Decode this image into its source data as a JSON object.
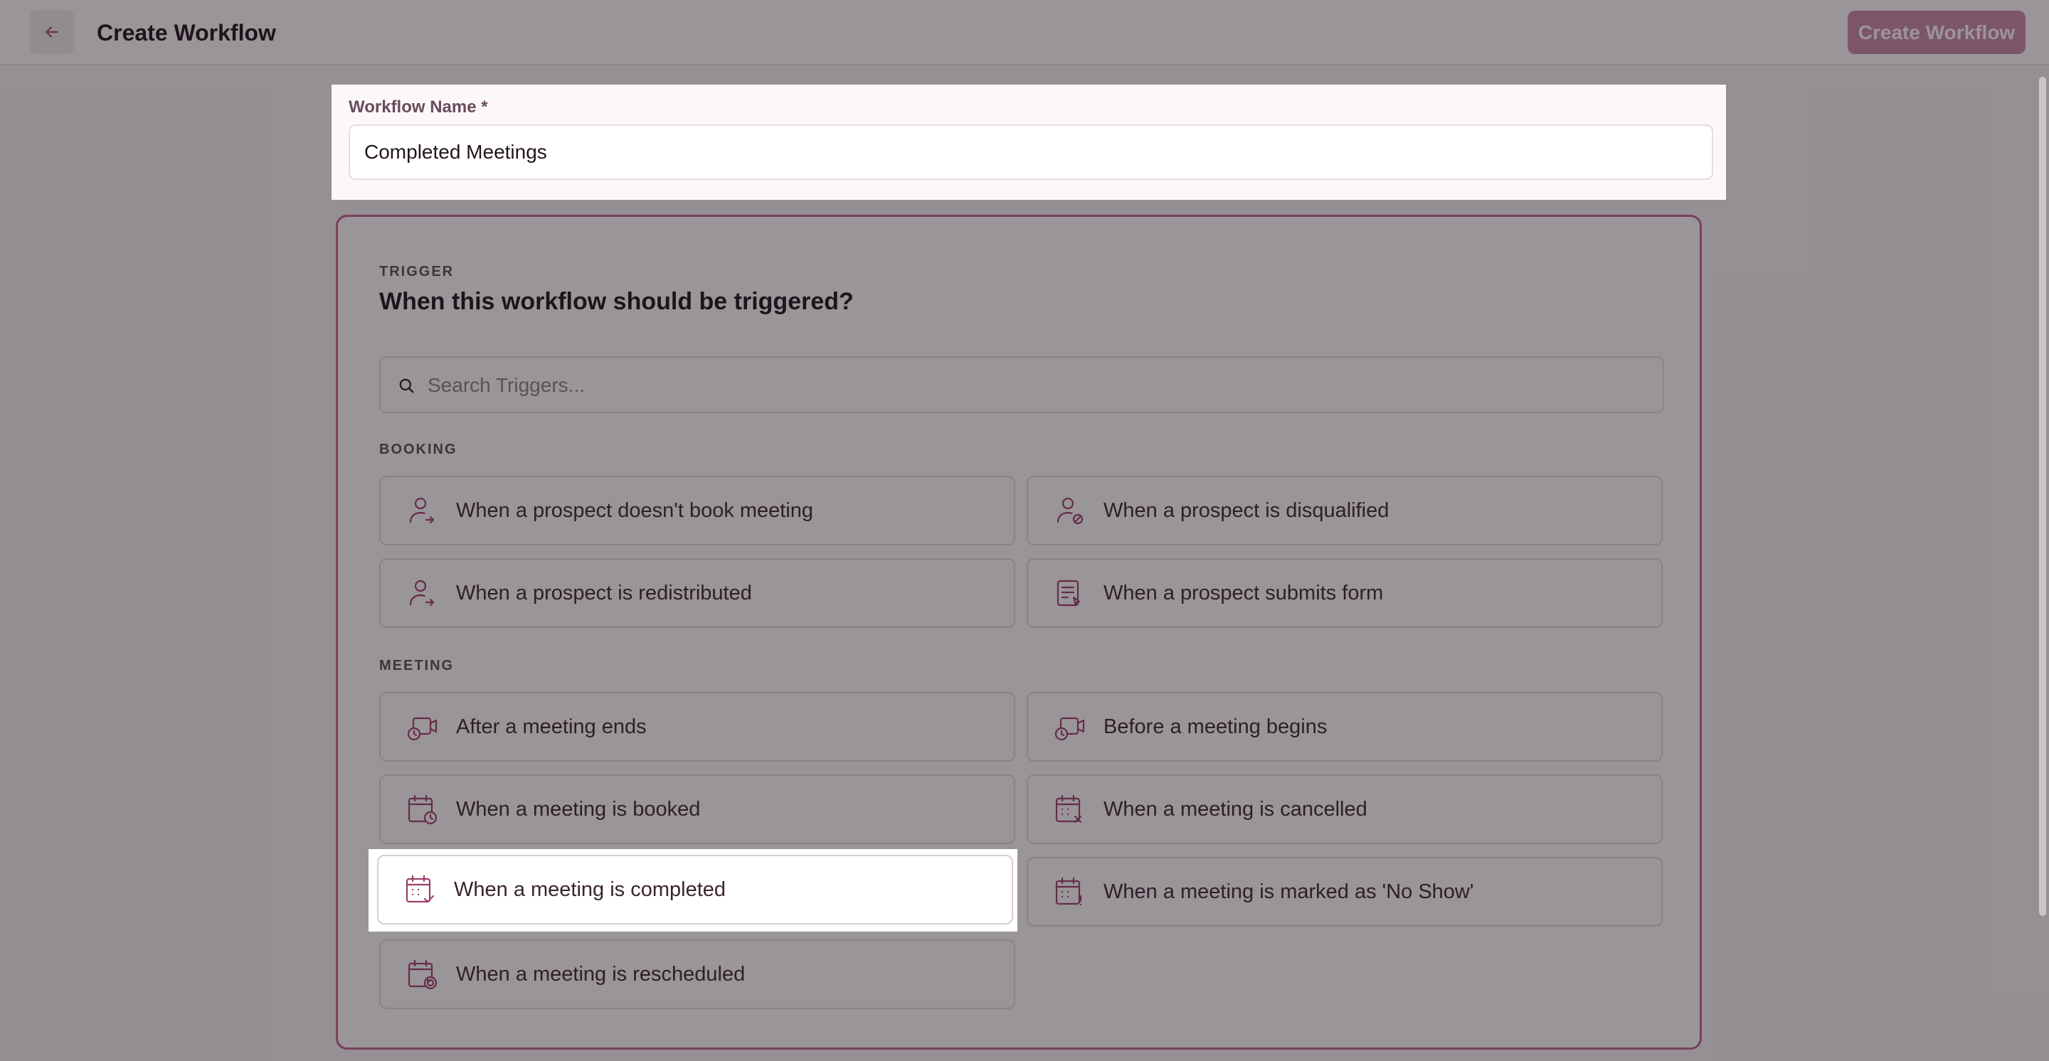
{
  "header": {
    "title": "Create Workflow",
    "primary_button": "Create Workflow"
  },
  "workflow_name": {
    "label": "Workflow Name *",
    "value": "Completed Meetings"
  },
  "trigger": {
    "eyebrow": "TRIGGER",
    "title": "When this workflow should be triggered?",
    "search_placeholder": "Search Triggers...",
    "groups": [
      {
        "label": "BOOKING",
        "options": [
          {
            "label": "When a prospect doesn't book meeting",
            "icon": "user-arrow-icon"
          },
          {
            "label": "When a prospect is disqualified",
            "icon": "user-block-icon"
          },
          {
            "label": "When a prospect is redistributed",
            "icon": "user-arrow-icon"
          },
          {
            "label": "When a prospect submits form",
            "icon": "form-icon"
          }
        ]
      },
      {
        "label": "MEETING",
        "options": [
          {
            "label": "After a meeting ends",
            "icon": "video-clock-icon"
          },
          {
            "label": "Before a meeting begins",
            "icon": "video-clock-icon"
          },
          {
            "label": "When a meeting is booked",
            "icon": "calendar-clock-icon"
          },
          {
            "label": "When a meeting is cancelled",
            "icon": "calendar-x-icon"
          },
          {
            "label": "When a meeting is completed",
            "icon": "calendar-check-icon",
            "highlighted": true
          },
          {
            "label": "When a meeting is marked as 'No Show'",
            "icon": "calendar-alert-icon"
          },
          {
            "label": "When a meeting is rescheduled",
            "icon": "calendar-refresh-icon"
          }
        ]
      }
    ]
  },
  "colors": {
    "accent": "#c0628f",
    "icon": "#9b3f69",
    "button_bg": "#c98aa8"
  }
}
